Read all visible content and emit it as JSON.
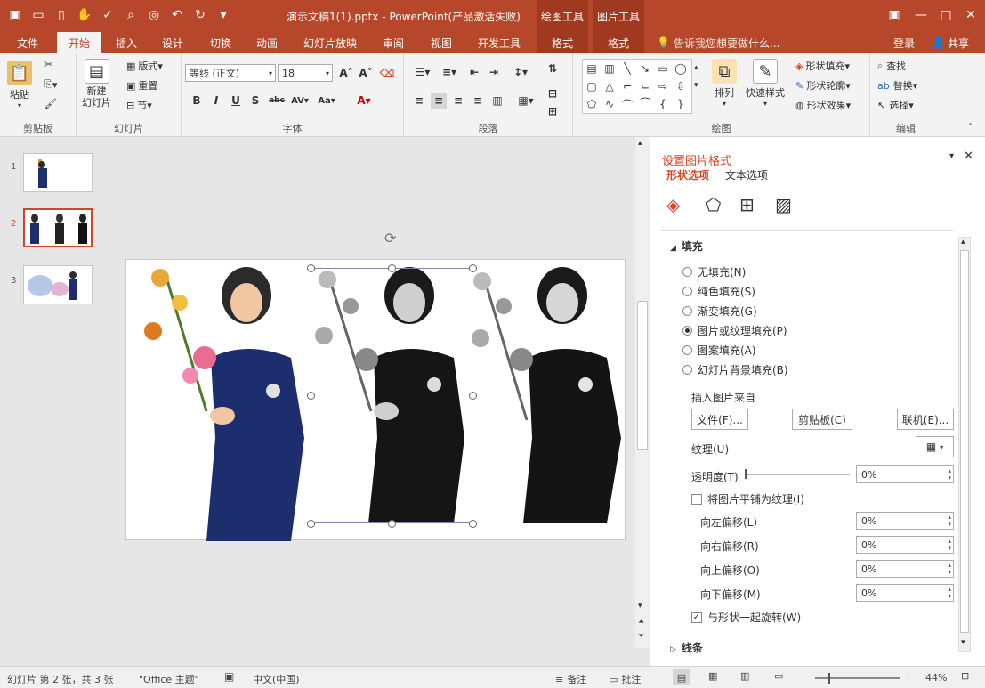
{
  "window": {
    "title": "演示文稿1(1).pptx - PowerPoint(产品激活失败)",
    "context_groups": [
      "绘图工具",
      "图片工具"
    ]
  },
  "tabs": [
    "文件",
    "开始",
    "插入",
    "设计",
    "切换",
    "动画",
    "幻灯片放映",
    "审阅",
    "视图",
    "开发工具",
    "格式",
    "格式"
  ],
  "tell_me": "告诉我您想要做什么...",
  "account": {
    "login": "登录",
    "share": "共享"
  },
  "ribbon": {
    "clipboard": {
      "label": "剪贴板",
      "paste": "粘贴"
    },
    "slides": {
      "label": "幻灯片",
      "new_slide": "新建\n幻灯片",
      "layout": "版式",
      "reset": "重置",
      "section": "节"
    },
    "font": {
      "label": "字体",
      "font_name": "等线 (正文)",
      "font_size": "18"
    },
    "paragraph": {
      "label": "段落"
    },
    "drawing": {
      "label": "绘图",
      "arrange": "排列",
      "quick_styles": "快速样式",
      "shape_fill": "形状填充",
      "shape_outline": "形状轮廓",
      "shape_effects": "形状效果"
    },
    "editing": {
      "label": "编辑",
      "find": "查找",
      "replace": "替换",
      "select": "选择"
    }
  },
  "thumbnails": [
    {
      "num": "1",
      "active": false
    },
    {
      "num": "2",
      "active": true
    },
    {
      "num": "3",
      "active": false
    }
  ],
  "format_pane": {
    "title": "设置图片格式",
    "tab_shape": "形状选项",
    "tab_text": "文本选项",
    "section_fill": "填充",
    "fill_options": [
      {
        "label": "无填充(N)",
        "checked": false
      },
      {
        "label": "纯色填充(S)",
        "checked": false
      },
      {
        "label": "渐变填充(G)",
        "checked": false
      },
      {
        "label": "图片或纹理填充(P)",
        "checked": true
      },
      {
        "label": "图案填充(A)",
        "checked": false
      },
      {
        "label": "幻灯片背景填充(B)",
        "checked": false
      }
    ],
    "insert_from": "插入图片来自",
    "btn_file": "文件(F)...",
    "btn_clipboard": "剪贴板(C)",
    "btn_online": "联机(E)...",
    "texture": "纹理(U)",
    "transparency_label": "透明度(T)",
    "transparency_value": "0%",
    "tile_label": "将图片平铺为纹理(I)",
    "offsets": [
      {
        "label": "向左偏移(L)",
        "value": "0%"
      },
      {
        "label": "向右偏移(R)",
        "value": "0%"
      },
      {
        "label": "向上偏移(O)",
        "value": "0%"
      },
      {
        "label": "向下偏移(M)",
        "value": "0%"
      }
    ],
    "rotate_label": "与形状一起旋转(W)",
    "rotate_checked": true,
    "section_line": "线条"
  },
  "status": {
    "slide_info": "幻灯片 第 2 张，共 3 张",
    "theme": "\"Office 主题\"",
    "language": "中文(中国)",
    "notes": "备注",
    "comments": "批注",
    "zoom": "44%"
  },
  "colors": {
    "brand": "#b7472a",
    "accent_text": "#d24726"
  }
}
